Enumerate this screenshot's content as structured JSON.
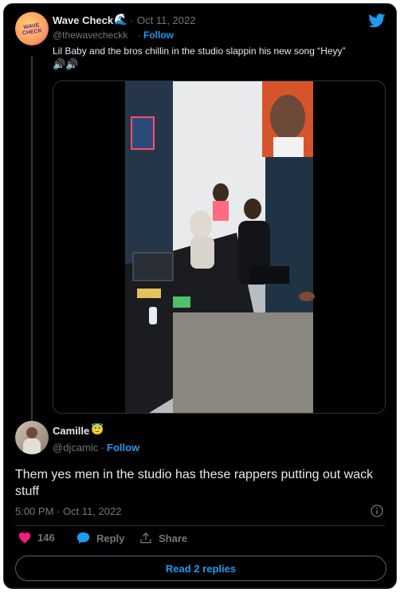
{
  "quoted_tweet": {
    "display_name": "Wave Check",
    "badge_emoji": "🌊",
    "date": "Oct 11, 2022",
    "handle": "@thewavecheckk",
    "follow_label": "Follow",
    "text": "Lil Baby and the bros chillin in the studio slappin his new song “Heyy”",
    "sound_emojis": "🔊🔊",
    "avatar_text": "WAVE CHECK"
  },
  "reply": {
    "display_name": "Camille",
    "badge_emoji": "😇",
    "handle": "@djcamic",
    "follow_label": "Follow",
    "text": "Them yes men in the studio has these rappers putting out wack stuff",
    "timestamp": "5:00 PM · Oct 11, 2022"
  },
  "actions": {
    "like_count": "146",
    "reply_label": "Reply",
    "share_label": "Share"
  },
  "read_replies_label": "Read 2 replies",
  "dot_sep": "·",
  "colors": {
    "accent": "#1d9bf0",
    "heart": "#f91880",
    "background": "#000000"
  }
}
